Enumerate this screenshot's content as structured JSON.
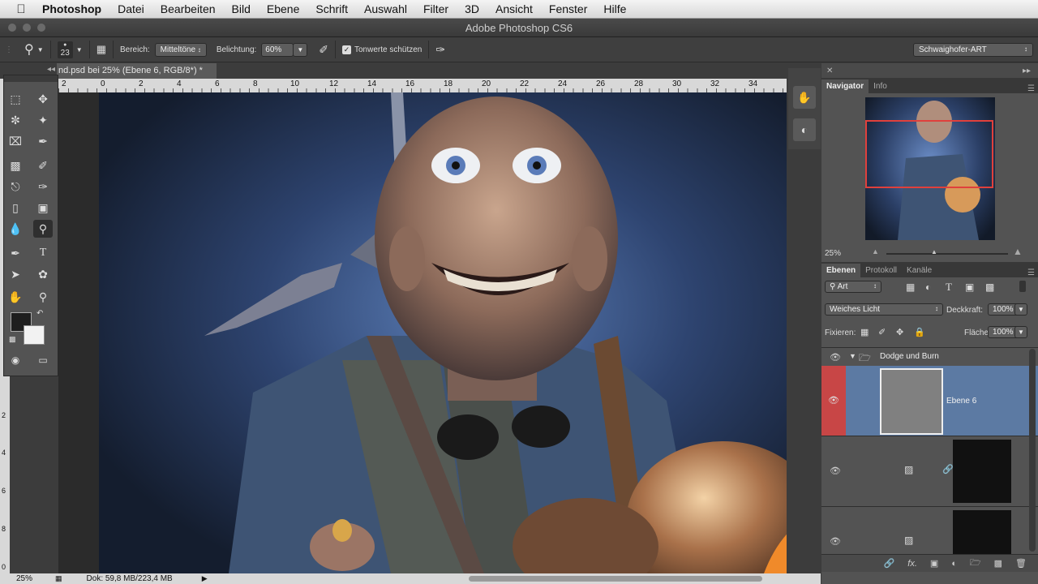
{
  "menubar": {
    "apple": "",
    "app_name": "Photoshop",
    "items": [
      "Datei",
      "Bearbeiten",
      "Bild",
      "Ebene",
      "Schrift",
      "Auswahl",
      "Filter",
      "3D",
      "Ansicht",
      "Fenster",
      "Hilfe"
    ]
  },
  "window": {
    "title": "Adobe Photoshop CS6"
  },
  "options": {
    "brush_size": "23",
    "bereich_label": "Bereich:",
    "bereich_value": "Mitteltöne",
    "belichtung_label": "Belichtung:",
    "belichtung_value": "60%",
    "tonwerte_label": "Tonwerte schützen",
    "workspace": "Schwaighofer-ART"
  },
  "document": {
    "tab_title": "nd.psd bei 25% (Ebene 6, RGB/8*) *",
    "ruler_h": [
      "2",
      "0",
      "2",
      "4",
      "6",
      "8",
      "10",
      "12",
      "14",
      "16",
      "18",
      "20",
      "22",
      "24",
      "26",
      "28",
      "30",
      "32",
      "34"
    ],
    "ruler_v": [
      "2",
      "4",
      "6",
      "8",
      "0"
    ]
  },
  "status": {
    "zoom": "25%",
    "doc_size": "Dok: 59,8 MB/223,4 MB"
  },
  "tools": {
    "items": [
      "marquee-tool",
      "move-tool",
      "lasso-tool",
      "magic-wand-tool",
      "crop-tool",
      "eyedropper-tool",
      "healing-brush-tool",
      "brush-tool",
      "clone-stamp-tool",
      "history-brush-tool",
      "eraser-tool",
      "gradient-tool",
      "blur-tool",
      "dodge-tool",
      "pen-tool",
      "type-tool",
      "path-selection-tool",
      "shape-tool",
      "hand-tool",
      "zoom-tool"
    ],
    "active": "dodge-tool",
    "foreground_color": "#1e1e1e",
    "background_color": "#f2f2f2"
  },
  "navigator": {
    "tabs": [
      "Navigator",
      "Info"
    ],
    "zoom": "25%"
  },
  "layers": {
    "tabs": [
      "Ebenen",
      "Protokoll",
      "Kanäle"
    ],
    "filter": "Art",
    "blend_mode": "Weiches Licht",
    "opacity_label": "Deckkraft:",
    "opacity": "100%",
    "fix_label": "Fixieren:",
    "fill_label": "Fläche:",
    "fill": "100%",
    "group_name": "Dodge und Burn",
    "layer6_name": "Ebene 6",
    "footer_icons": [
      "link-icon",
      "fx-icon",
      "mask-icon",
      "adjustment-icon",
      "folder-icon",
      "new-layer-icon",
      "trash-icon"
    ],
    "footer_fx": "fx."
  },
  "colors": {
    "selection_blue": "#5c7aa3",
    "layer_visibility_red": "#c84646",
    "navigator_frame": "#e0403c"
  }
}
